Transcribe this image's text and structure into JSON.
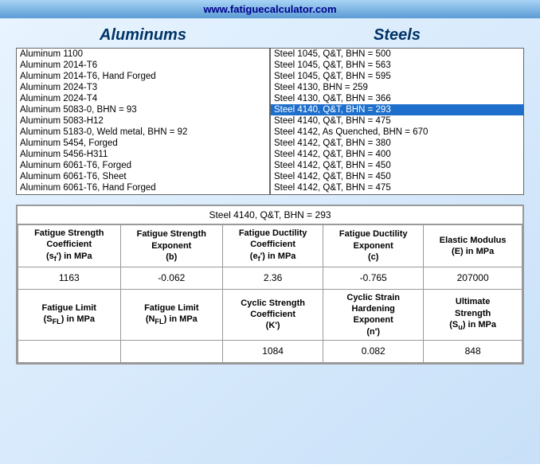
{
  "header": {
    "url": "www.fatiguecalculator.com"
  },
  "aluminums": {
    "title": "Aluminums",
    "items": [
      "Aluminum 1100",
      "Aluminum 2014-T6",
      "Aluminum 2014-T6, Hand Forged",
      "Aluminum 2024-T3",
      "Aluminum 2024-T4",
      "Aluminum 5083-0, BHN = 93",
      "Aluminum 5083-H12",
      "Aluminum 5183-0, Weld metal, BHN = 92",
      "Aluminum 5454, Forged",
      "Aluminum 5456-H311",
      "Aluminum 6061-T6, Forged",
      "Aluminum 6061-T6, Sheet",
      "Aluminum 6061-T6, Hand Forged"
    ]
  },
  "steels": {
    "title": "Steels",
    "items": [
      "Steel 1045, Q&T, BHN = 500",
      "Steel 1045, Q&T, BHN = 563",
      "Steel 1045, Q&T, BHN = 595",
      "Steel 4130, BHN = 259",
      "Steel 4130, Q&T, BHN = 366",
      "Steel 4140, Q&T, BHN = 293",
      "Steel 4140, Q&T, BHN = 475",
      "Steel 4142, As Quenched, BHN = 670",
      "Steel 4142, Q&T, BHN = 380",
      "Steel 4142, Q&T, BHN = 400",
      "Steel 4142, Q&T, BHN = 450",
      "Steel 4142, Q&T, BHN = 450",
      "Steel 4142, Q&T, BHN = 475"
    ],
    "selected_index": 5
  },
  "properties": {
    "title": "Steel 4140, Q&T, BHN = 293",
    "headers_row1": [
      "Fatigue Strength Coefficient (sf') in MPa",
      "Fatigue Strength Exponent (b)",
      "Fatigue Ductility Coefficient (ef') in MPa",
      "Fatigue Ductility Exponent (c)",
      "Elastic Modulus (E) in MPa"
    ],
    "values_row1": [
      "1163",
      "-0.062",
      "2.36",
      "-0.765",
      "207000"
    ],
    "headers_row2": [
      "Fatigue Limit (SFL) in MPa",
      "Fatigue Limit (NFL) in MPa",
      "Cyclic Strength Coefficient (K')",
      "Cyclic Strain Hardening Exponent (n')",
      "Ultimate Strength (Su) in MPa"
    ],
    "values_row2": [
      "",
      "",
      "1084",
      "0.082",
      "848"
    ]
  }
}
